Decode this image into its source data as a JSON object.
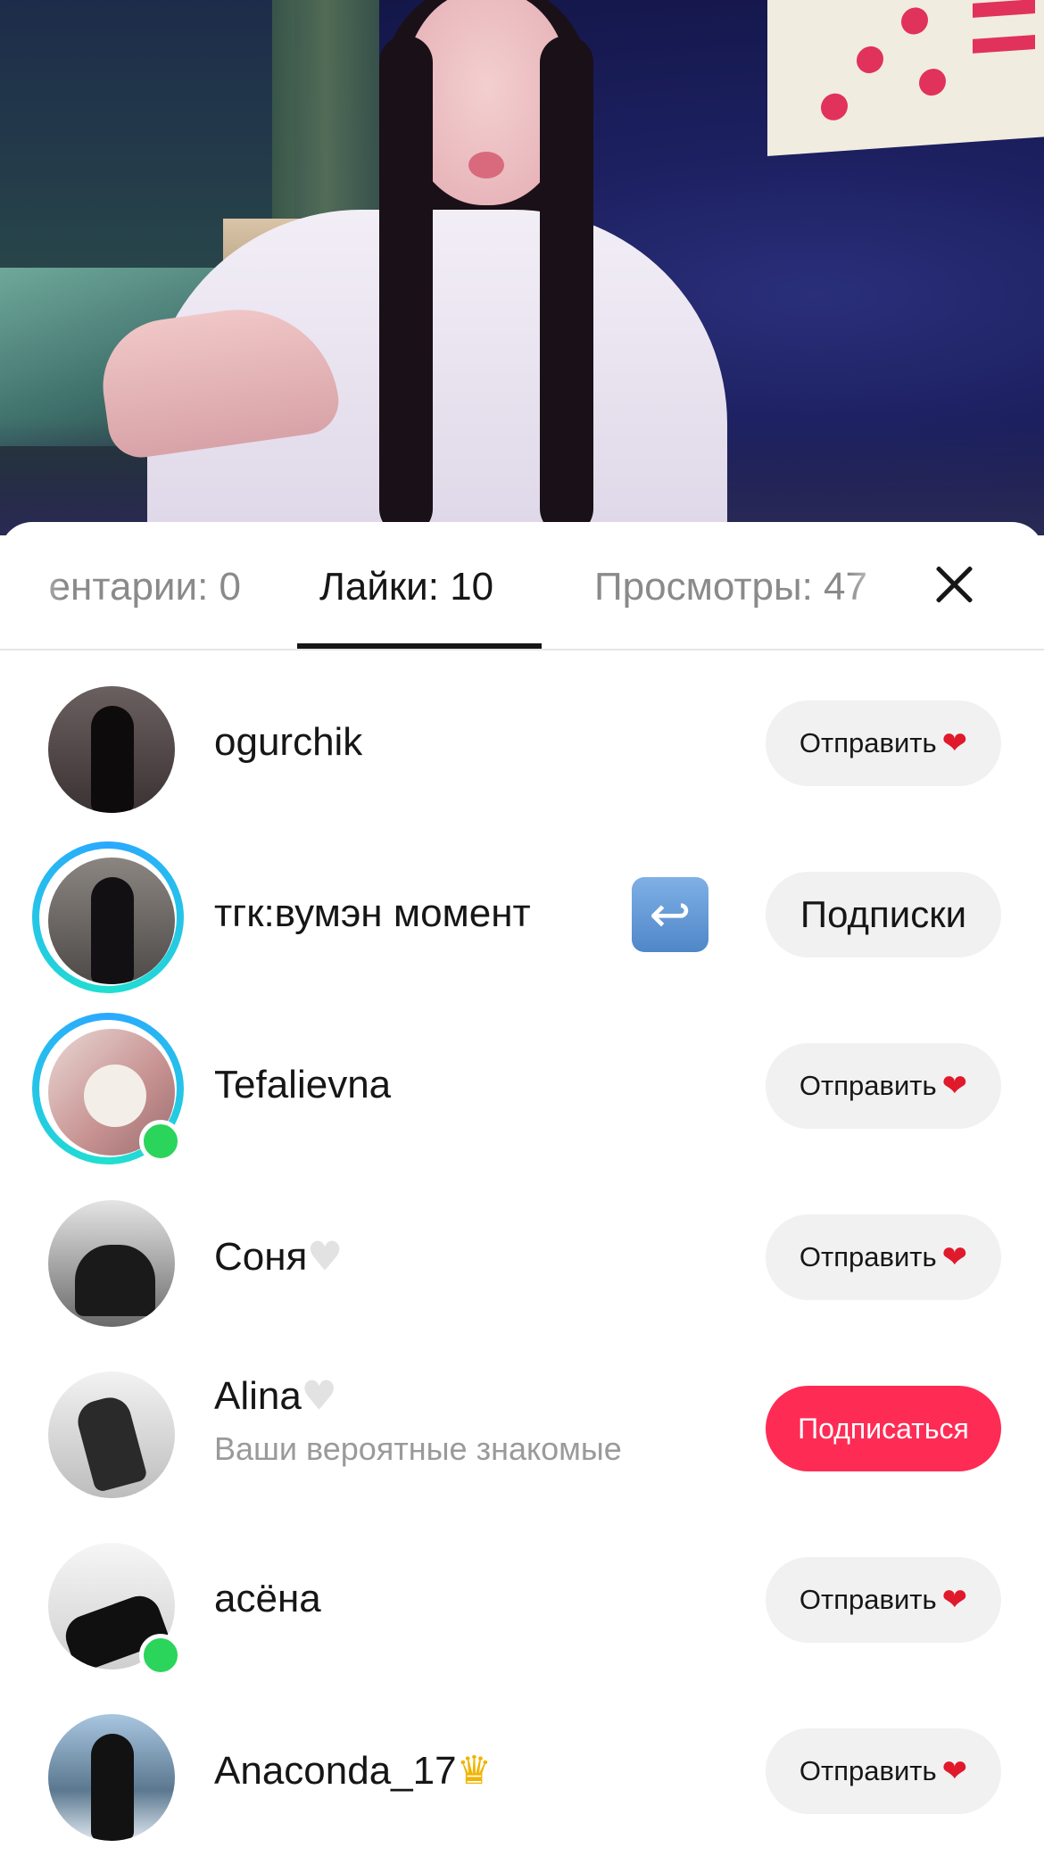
{
  "tabs": {
    "comments": "ентарии: 0",
    "likes": "Лайки: 10",
    "views": "Просмотры: 47"
  },
  "icons": {
    "close": "close-icon",
    "send_heart": "red-heart",
    "follow_back": "return-arrow-emoji"
  },
  "colors": {
    "accent_red": "#fe2c55",
    "online_green": "#2bd45b",
    "story_ring": "#2aa8ff"
  },
  "users": [
    {
      "name": "ogurchik",
      "emoji": "",
      "subtitle": "",
      "button": "Отправить",
      "button_icon": "❤"
    },
    {
      "name": "тгк:вумэн момент",
      "emoji": "",
      "badge": "↩",
      "subtitle": "",
      "button": "Подписки",
      "button_icon": ""
    },
    {
      "name": "Tefalievna",
      "emoji": "",
      "subtitle": "",
      "button": "Отправить",
      "button_icon": "❤"
    },
    {
      "name": "Соня",
      "emoji": "♥",
      "subtitle": "",
      "button": "Отправить",
      "button_icon": "❤"
    },
    {
      "name": "Alina",
      "emoji": "♥",
      "subtitle": "Ваши вероятные знакомые",
      "button": "Подписаться",
      "button_icon": ""
    },
    {
      "name": "асёна",
      "emoji": "",
      "subtitle": "",
      "button": "Отправить",
      "button_icon": "❤"
    },
    {
      "name": "Anaconda_17",
      "emoji": "♛",
      "subtitle": "",
      "button": "Отправить",
      "button_icon": "❤"
    }
  ]
}
